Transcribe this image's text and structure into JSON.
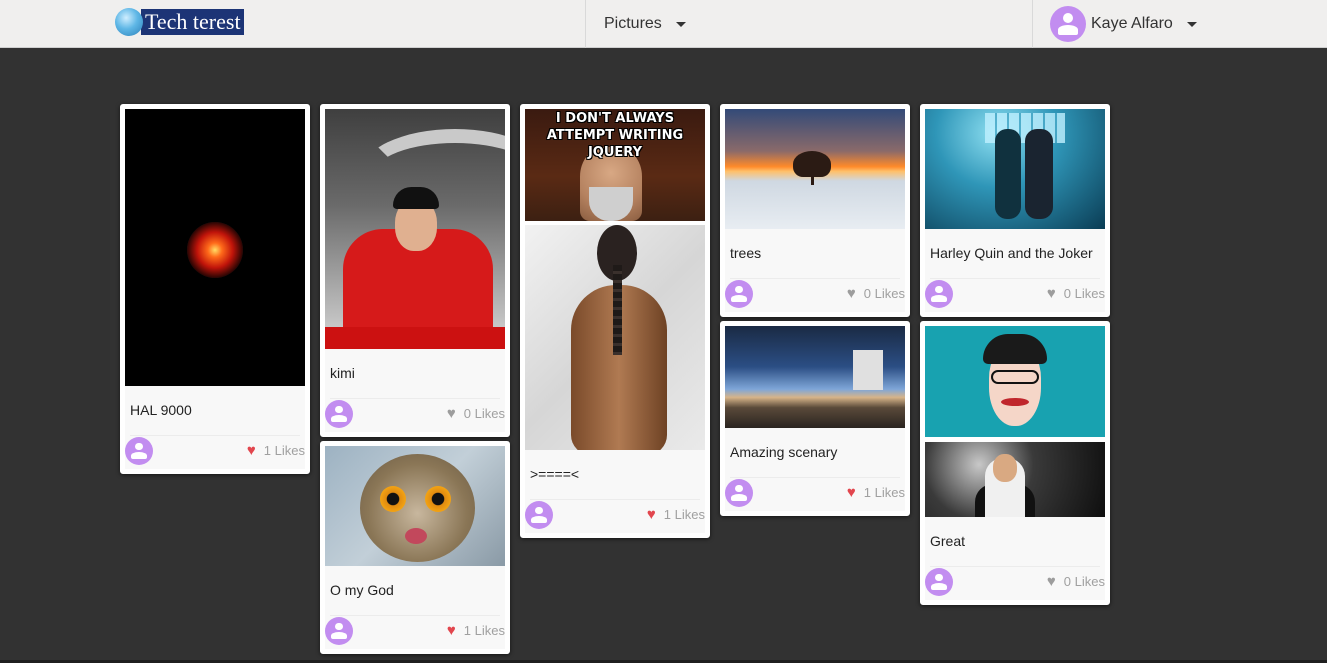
{
  "navbar": {
    "brand_text": "Tech terest",
    "pictures_menu_label": "Pictures",
    "user_name": "Kaye Alfaro"
  },
  "pins": [
    {
      "caption": "HAL 9000",
      "likes_text": "1 Likes",
      "liked": true
    },
    {
      "caption": "kimi",
      "likes_text": "0 Likes",
      "liked": false
    },
    {
      "caption": "O my God",
      "likes_text": "1 Likes",
      "liked": true
    },
    {
      "caption": ">====<",
      "likes_text": "1 Likes",
      "liked": true,
      "meme_text": "I DON'T ALWAYS ATTEMPT WRITING JQUERY"
    },
    {
      "caption": "trees",
      "likes_text": "0 Likes",
      "liked": false
    },
    {
      "caption": "Amazing scenary",
      "likes_text": "1 Likes",
      "liked": true
    },
    {
      "caption": "Harley Quin and the Joker",
      "likes_text": "0 Likes",
      "liked": false
    },
    {
      "caption": "Great",
      "likes_text": "0 Likes",
      "liked": false
    }
  ],
  "icons": {
    "heart_glyph": "♥",
    "liked_color": "#e2464e",
    "unliked_color": "#9d9d9d",
    "avatar_color": "#c28df0"
  },
  "colors": {
    "page_background": "#323232",
    "navbar_background": "#f0efee",
    "brand_background": "#1c3476"
  }
}
